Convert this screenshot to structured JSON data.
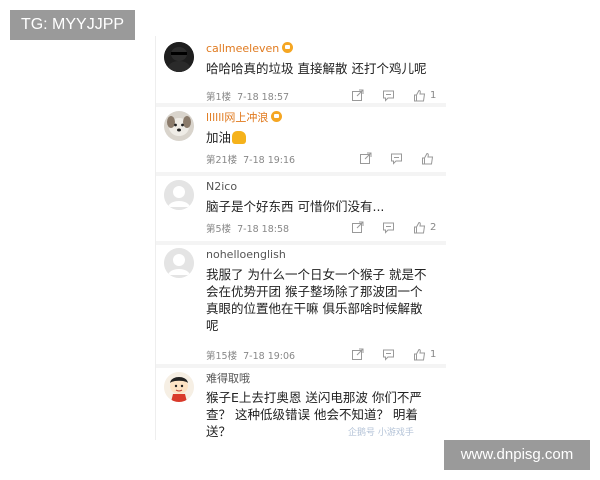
{
  "tag": {
    "text": "TG: MYYJJPP"
  },
  "site_watermark": {
    "text": "www.dnpisg.com"
  },
  "inner_watermark": {
    "text": "企鹅号 小游戏手"
  },
  "colors": {
    "vip_badge": "#f5a623",
    "vip_name": "#e07a1f",
    "meta": "#888888",
    "flex_emoji": "#f5b21b"
  },
  "comments": [
    {
      "name": "callmeeleven",
      "vip": true,
      "lines": [
        "哈哈哈真的垃圾 直接解散 还打个鸡儿呢"
      ],
      "floor": "第1楼",
      "time": "7-18 18:57",
      "likes": "1",
      "avatar_icon": "dark-avatar-icon"
    },
    {
      "name": "llllll网上冲浪",
      "vip": true,
      "lines": [
        "加油"
      ],
      "emoji": "flexed-biceps",
      "floor": "第21楼",
      "time": "7-18 19:16",
      "likes": "",
      "avatar_icon": "dog-avatar-icon"
    },
    {
      "name": "N2ico",
      "vip": false,
      "lines": [
        "脑子是个好东西 可惜你们没有..."
      ],
      "floor": "第5楼",
      "time": "7-18 18:58",
      "likes": "2",
      "avatar_icon": "default-avatar-icon"
    },
    {
      "name": "nohelloenglish",
      "vip": false,
      "lines": [
        "我服了 为什么一个日女一个猴子 就是不",
        "会在优势开团 猴子整场除了那波团一个",
        "真眼的位置他在干嘛 俱乐部啥时候解散",
        "呢"
      ],
      "floor": "第15楼",
      "time": "7-18 19:06",
      "likes": "1",
      "avatar_icon": "default-avatar-icon"
    },
    {
      "name": "难得取哦",
      "vip": false,
      "lines": [
        "猴子E上去打奥恩 送闪电那波  你们不严",
        "查？  这种低级错误 他会不知道？ 明着",
        "送？"
      ],
      "floor": "",
      "time": "",
      "likes": "",
      "avatar_icon": "cartoon-avatar-icon"
    }
  ]
}
